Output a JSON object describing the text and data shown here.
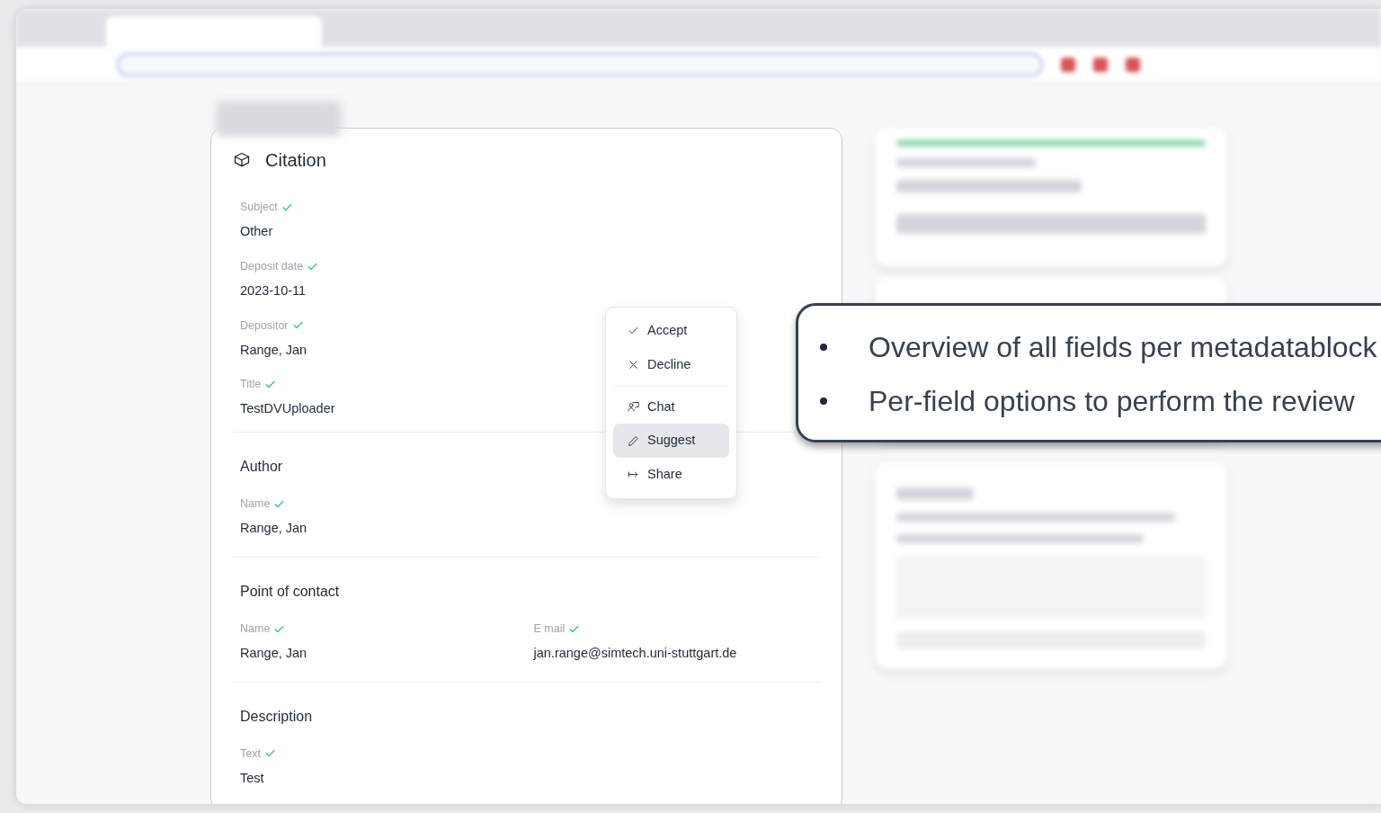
{
  "citation": {
    "title": "Citation",
    "fields": [
      {
        "label": "Subject",
        "value": "Other",
        "checked": true
      },
      {
        "label": "Deposit date",
        "value": "2023-10-11",
        "checked": true
      },
      {
        "label": "Depositor",
        "value": "Range, Jan",
        "checked": true
      },
      {
        "label": "Title",
        "value": "TestDVUploader",
        "checked": true
      }
    ]
  },
  "sections": [
    {
      "title": "Author",
      "fields": [
        {
          "label": "Name",
          "value": "Range, Jan",
          "checked": true
        }
      ]
    },
    {
      "title": "Point of contact",
      "fields": [
        {
          "label": "Name",
          "value": "Range, Jan",
          "checked": true
        },
        {
          "label": "E mail",
          "value": "jan.range@simtech.uni-stuttgart.de",
          "checked": true
        }
      ]
    },
    {
      "title": "Description",
      "fields": [
        {
          "label": "Text",
          "value": "Test",
          "checked": true
        }
      ]
    }
  ],
  "menu": {
    "groups": [
      [
        {
          "kind": "accept",
          "label": "Accept",
          "selected": false
        },
        {
          "kind": "decline",
          "label": "Decline",
          "selected": false
        }
      ],
      [
        {
          "kind": "chat",
          "label": "Chat",
          "selected": false
        },
        {
          "kind": "suggest",
          "label": "Suggest",
          "selected": true
        },
        {
          "kind": "share",
          "label": "Share",
          "selected": false
        }
      ]
    ]
  },
  "callout": {
    "bullets": [
      "Overview of all fields per metadatablock",
      "Per-field options to perform the review"
    ]
  }
}
